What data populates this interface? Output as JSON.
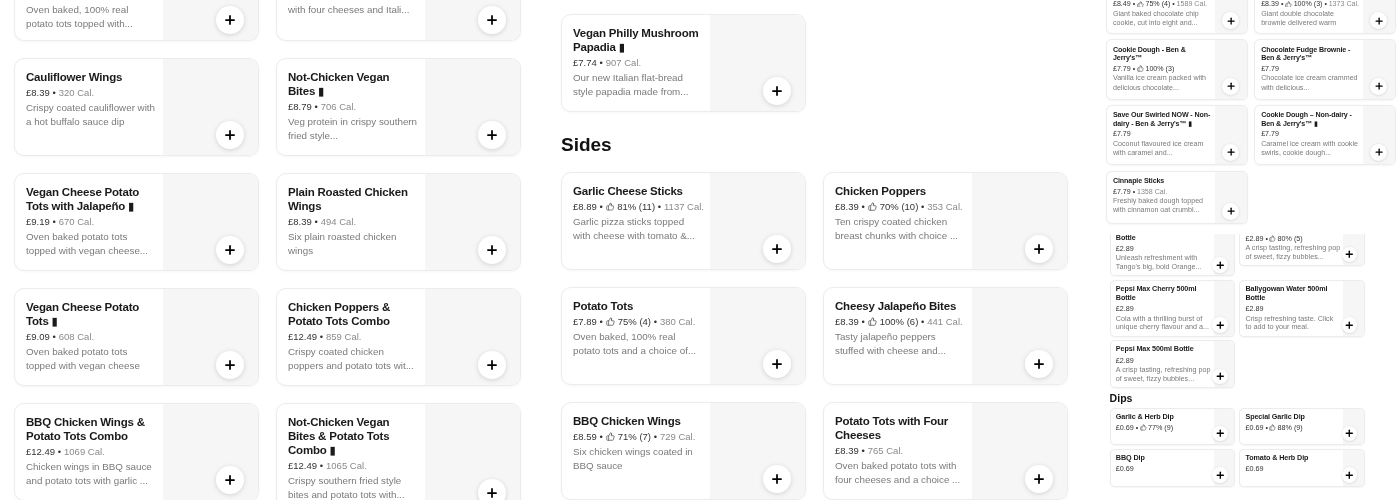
{
  "columns": [
    {
      "sections": [
        {
          "items": [
            {
              "kind": "cut",
              "description": "Oven baked, 100% real potato tots topped with..."
            },
            {
              "kind": "cut",
              "description": "with four cheeses and Itali..."
            },
            {
              "kind": "full",
              "title": "Cauliflower Wings",
              "price": "£8.39 •",
              "calories": "320 Cal.",
              "description": "Crispy coated cauliflower with a hot buffalo sauce dip"
            },
            {
              "kind": "full",
              "title": "Not-Chicken Vegan Bites ▮",
              "price": "£8.79 •",
              "calories": "706 Cal.",
              "description": "Veg protein in crispy southern fried style..."
            },
            {
              "kind": "full",
              "title": "Vegan Cheese Potato Tots with Jalapeño ▮",
              "price": "£9.19 •",
              "calories": "670 Cal.",
              "description": "Oven baked potato tots topped with vegan cheese..."
            },
            {
              "kind": "full",
              "title": "Plain Roasted Chicken Wings",
              "price": "£8.39 •",
              "calories": "494 Cal.",
              "description": "Six plain roasted chicken wings"
            },
            {
              "kind": "full",
              "title": "Vegan Cheese Potato Tots ▮",
              "price": "£9.09 •",
              "calories": "608 Cal.",
              "description": "Oven baked potato tots topped with vegan cheese"
            },
            {
              "kind": "full",
              "title": "Chicken Poppers & Potato Tots Combo",
              "price": "£12.49 •",
              "calories": "859 Cal.",
              "description": "Crispy coated chicken poppers and potato tots wit..."
            },
            {
              "kind": "full",
              "title": "BBQ Chicken Wings & Potato Tots Combo",
              "price": "£12.49 •",
              "calories": "1069 Cal.",
              "description": "Chicken wings in BBQ sauce and potato tots with garlic ..."
            },
            {
              "kind": "full",
              "title": "Not-Chicken Vegan Bites & Potato Tots Combo ▮",
              "price": "£12.49 •",
              "calories": "1065 Cal.",
              "description": "Crispy southern fried style bites and potato tots with..."
            }
          ]
        }
      ]
    },
    {
      "sections": [
        {
          "items": [
            {
              "kind": "full",
              "title": "Vegan Philly Mushroom Papadia ▮",
              "price": "£7.74 •",
              "calories": "907 Cal.",
              "description": "Our new Italian flat-bread style papadia made from..."
            }
          ]
        },
        {
          "heading": "Sides",
          "items": [
            {
              "kind": "full",
              "title": "Garlic Cheese Sticks",
              "price": "£8.89 •",
              "rating": "81% (11) •",
              "calories": "1137 Cal.",
              "description": "Garlic pizza sticks topped with cheese with tomato &..."
            },
            {
              "kind": "full",
              "title": "Chicken Poppers",
              "price": "£8.39 •",
              "rating": "70% (10) •",
              "calories": "353 Cal.",
              "description": "Ten crispy coated chicken breast chunks with choice ..."
            },
            {
              "kind": "full",
              "title": "Potato Tots",
              "price": "£7.89 •",
              "rating": "75% (4) •",
              "calories": "380 Cal.",
              "description": "Oven baked, 100% real potato tots and a choice of..."
            },
            {
              "kind": "full",
              "title": "Cheesy Jalapeño Bites",
              "price": "£8.39 •",
              "rating": "100% (6) •",
              "calories": "441 Cal.",
              "description": "Tasty jalapeño peppers stuffed with cheese and..."
            },
            {
              "kind": "full",
              "title": "BBQ Chicken Wings",
              "price": "£8.59 •",
              "rating": "71% (7) •",
              "calories": "729 Cal.",
              "description": "Six chicken wings coated in BBQ sauce"
            },
            {
              "kind": "full",
              "title": "Potato Tots with Four Cheeses",
              "price": "£8.39 •",
              "calories": "765 Cal.",
              "description": "Oven baked potato tots with four cheeses and a choice ..."
            }
          ]
        }
      ]
    }
  ],
  "preview": {
    "pages": [
      {
        "sections": [
          {
            "items": [
              {
                "kind": "cut",
                "price": "£8.49 •",
                "rating": "75% (4) •",
                "calories": "1589 Cal.",
                "description": "Giant baked chocolate chip cookie, cut into eight and..."
              },
              {
                "kind": "cut",
                "price": "£8.39 •",
                "rating": "100% (3) •",
                "calories": "1373 Cal.",
                "description": "Giant double chocolate brownie delivered warm"
              },
              {
                "kind": "full",
                "title": "Cookie Dough - Ben & Jerry's™",
                "price": "£7.79 •",
                "rating": "100% (3)",
                "description": "Vanilla ice cream packed with delicious chocolate..."
              },
              {
                "kind": "full",
                "title": "Chocolate Fudge Brownie - Ben & Jerry's™",
                "price": "£7.79",
                "description": "Chocolate ice cream crammed with delicious..."
              },
              {
                "kind": "full",
                "title": "Save Our Swirled NOW - Non-dairy - Ben & Jerry's™ ▮",
                "price": "£7.79",
                "description": "Coconut flavoured ice cream with caramel and..."
              },
              {
                "kind": "full",
                "title": "Cookie Dough – Non-dairy - Ben & Jerry's™ ▮",
                "price": "£7.79",
                "description": "Caramel ice cream with cookie swirls, cookie dough..."
              },
              {
                "kind": "full",
                "title": "Cinnapie Sticks",
                "price": "£7.79 •",
                "calories": "1358 Cal.",
                "description": "Freshly baked dough topped with cinnamon oat crumbl..."
              }
            ]
          }
        ]
      },
      {
        "sections": [
          {
            "items": [
              {
                "kind": "cut",
                "title": "Bottle",
                "price": "£2.89",
                "description": "Unleash refreshment with Tango's big, bold Orange..."
              },
              {
                "kind": "cut",
                "price": "£2.89 •",
                "rating": "80% (5)",
                "description": "A crisp tasting, refreshing pop of sweet, fizzy bubbles..."
              },
              {
                "kind": "full",
                "title": "Pepsi Max Cherry 500ml Bottle",
                "price": "£2.89",
                "description": "Cola with a thrilling burst of unique cherry flavour and a..."
              },
              {
                "kind": "full",
                "title": "Ballygowan Water 500ml Bottle",
                "price": "£2.89",
                "description": "Crisp refreshing taste. Click to add to your meal."
              },
              {
                "kind": "full",
                "title": "Pepsi Max 500ml Bottle",
                "price": "£2.89",
                "description": "A crisp tasting, refreshing pop of sweet, fizzy bubbles..."
              }
            ]
          },
          {
            "heading": "Dips",
            "items": [
              {
                "kind": "full",
                "title": "Garlic & Herb Dip",
                "price": "£0.69 •",
                "rating": "77% (9)"
              },
              {
                "kind": "full",
                "title": "Special Garlic Dip",
                "price": "£0.69 •",
                "rating": "88% (9)"
              },
              {
                "kind": "full",
                "title": "BBQ Dip",
                "price": "£0.69"
              },
              {
                "kind": "full",
                "title": "Tomato & Herb Dip",
                "price": "£0.69"
              }
            ]
          }
        ]
      }
    ]
  }
}
